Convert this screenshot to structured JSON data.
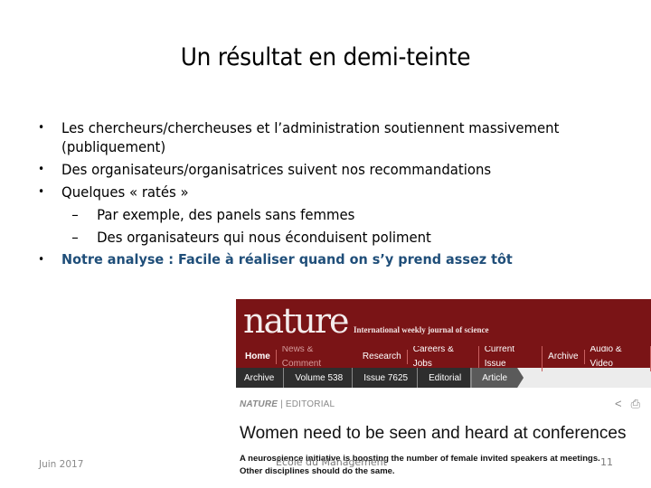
{
  "slide": {
    "title": "Un résultat en demi-teinte",
    "bullets": [
      {
        "marker": "•",
        "text": "Les chercheurs/chercheuses et l’administration soutiennent massivement"
      },
      {
        "marker": "",
        "text": "(publiquement)"
      },
      {
        "marker": "•",
        "text": "Des organisateurs/organisatrices suivent nos recommandations"
      },
      {
        "marker": "•",
        "text": "Quelques « ratés »"
      },
      {
        "marker": "–",
        "text": "Par exemple, des panels sans femmes"
      },
      {
        "marker": "–",
        "text": "Des organisateurs qui nous éconduisent poliment"
      },
      {
        "marker": "•",
        "text": "Notre analyse : Facile à réaliser quand on s’y prend assez tôt"
      }
    ],
    "accent_color": "#1f4e79"
  },
  "nature": {
    "logo": "nature",
    "tagline": "International weekly journal of science",
    "brand_color": "#7a1416",
    "nav": [
      "Home",
      "News & Comment",
      "Research",
      "Careers & Jobs",
      "Current Issue",
      "Archive",
      "Audio & Video"
    ],
    "breadcrumb": [
      "Archive",
      "Volume 538",
      "Issue 7625",
      "Editorial",
      "Article"
    ],
    "section_journal": "NATURE",
    "section_sep": " | ",
    "section_type": "EDITORIAL",
    "icons": {
      "share": "<",
      "print": "⎙"
    },
    "headline": "Women need to be seen and heard at conferences",
    "standfirst_1": "A neuroscience initiative is boosting the number of female invited speakers at meetings.",
    "standfirst_2": "Other disciplines should do the same."
  },
  "footer": {
    "date": "Juin 2017",
    "center": "Ecole du Management",
    "page": "11"
  }
}
